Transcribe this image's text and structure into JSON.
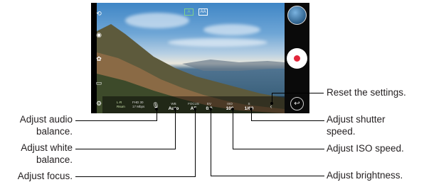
{
  "camera": {
    "icons": {
      "flip": "camera-flip-icon",
      "camera": "camera-icon",
      "effects": "effects-icon",
      "video": "video-icon",
      "settings": "settings-icon",
      "back": "back-icon",
      "reset": "reset-icon",
      "mic": "microphone-icon"
    },
    "top_modes": [
      "A",
      "AA"
    ],
    "info_left": [
      "L·R",
      "Rsum"
    ],
    "info_res": [
      "FHD 30",
      "17 Mbps"
    ],
    "controls": {
      "wb": {
        "label": "WB",
        "value": "Auto"
      },
      "focus": {
        "label": "FOCUS",
        "value": "AF"
      },
      "ev": {
        "label": "EV",
        "value": "0.0"
      },
      "iso": {
        "label": "ISO",
        "value": "100"
      },
      "shutter": {
        "label": "S",
        "value": "1/60"
      }
    },
    "record_color": "#e2263a"
  },
  "callouts": {
    "reset": "Reset the settings.",
    "audio_1": "Adjust audio",
    "audio_2": "balance.",
    "shutter_1": "Adjust shutter",
    "shutter_2": "speed.",
    "wb_1": "Adjust white",
    "wb_2": "balance.",
    "iso": "Adjust ISO speed.",
    "focus": "Adjust focus.",
    "brightness": "Adjust brightness."
  }
}
